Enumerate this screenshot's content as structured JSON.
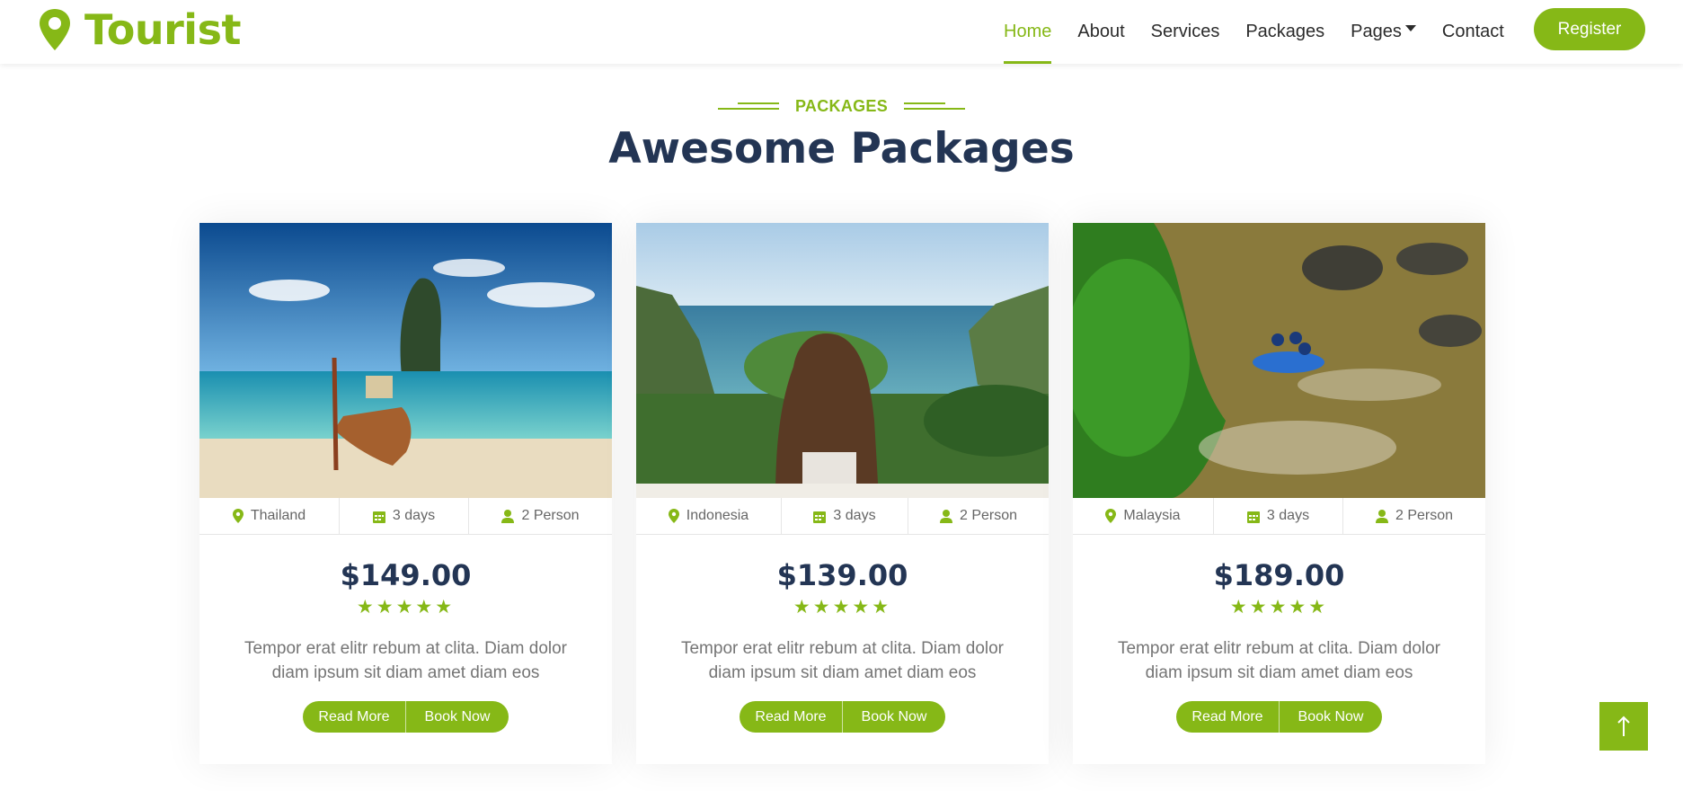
{
  "brand": {
    "name": "Tourist",
    "icon": "map-marker-icon"
  },
  "nav": {
    "items": [
      {
        "label": "Home",
        "active": true
      },
      {
        "label": "About"
      },
      {
        "label": "Services"
      },
      {
        "label": "Packages"
      },
      {
        "label": "Pages",
        "dropdown": true
      },
      {
        "label": "Contact"
      }
    ],
    "register_label": "Register"
  },
  "section": {
    "subtitle": "PACKAGES",
    "title": "Awesome Packages"
  },
  "packages": [
    {
      "location": "Thailand",
      "duration": "3 days",
      "persons": "2 Person",
      "price": "$149.00",
      "rating": 5,
      "stars": "★★★★★",
      "description": "Tempor erat elitr rebum at clita. Diam dolor diam ipsum sit diam amet diam eos",
      "read_more": "Read More",
      "book_now": "Book Now",
      "image": "tropical beach with longtail boat and limestone rock"
    },
    {
      "location": "Indonesia",
      "duration": "3 days",
      "persons": "2 Person",
      "price": "$139.00",
      "rating": 5,
      "stars": "★★★★★",
      "description": "Tempor erat elitr rebum at clita. Diam dolor diam ipsum sit diam amet diam eos",
      "read_more": "Read More",
      "book_now": "Book Now",
      "image": "woman overlooking tropical bay from cliff"
    },
    {
      "location": "Malaysia",
      "duration": "3 days",
      "persons": "2 Person",
      "price": "$189.00",
      "rating": 5,
      "stars": "★★★★★",
      "description": "Tempor erat elitr rebum at clita. Diam dolor diam ipsum sit diam amet diam eos",
      "read_more": "Read More",
      "book_now": "Book Now",
      "image": "white water rafting on a jungle river"
    }
  ],
  "colors": {
    "accent": "#86b817",
    "heading": "#233554",
    "text": "#757575"
  },
  "back_to_top": {
    "icon": "arrow-up-icon"
  }
}
